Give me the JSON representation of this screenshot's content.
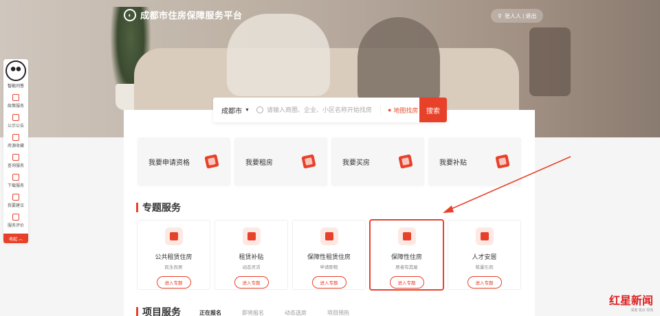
{
  "header": {
    "site_title": "成都市住房保障服务平台",
    "user_text": "张人人 | 退出"
  },
  "search": {
    "city": "成都市",
    "placeholder": "请输入商圈、企业、小区名称开始找房",
    "map_link": "地图找房",
    "button": "搜索"
  },
  "quick_cards": [
    {
      "label": "我要申请资格",
      "icon": "application-icon"
    },
    {
      "label": "我要租房",
      "icon": "rent-icon"
    },
    {
      "label": "我要买房",
      "icon": "buy-house-icon"
    },
    {
      "label": "我要补贴",
      "icon": "subsidy-icon"
    }
  ],
  "topic_section": {
    "title": "专题服务",
    "cards": [
      {
        "name": "公共租赁住房",
        "sub": "民生尚居",
        "button": "进入专题",
        "icon": "public-rental-icon"
      },
      {
        "name": "租赁补贴",
        "sub": "动态灵活",
        "button": "进入专题",
        "icon": "rent-subsidy-icon"
      },
      {
        "name": "保障性租赁住房",
        "sub": "申请即租",
        "button": "进入专题",
        "icon": "affordable-rental-icon"
      },
      {
        "name": "保障性住房",
        "sub": "居者有其屋",
        "button": "进入专题",
        "icon": "affordable-housing-icon",
        "highlighted": true
      },
      {
        "name": "人才安居",
        "sub": "筑巢引凤",
        "button": "进入专题",
        "icon": "talent-housing-icon"
      }
    ]
  },
  "project_section": {
    "title": "项目服务",
    "tabs": [
      "正在报名",
      "即将报名",
      "动态选房",
      "项目预热"
    ],
    "active_tab": "正在报名"
  },
  "sidebar": {
    "mascot_label": "智能问答",
    "items": [
      {
        "label": "政策服务",
        "icon": "policy-icon"
      },
      {
        "label": "公示公告",
        "icon": "notice-icon"
      },
      {
        "label": "房源收藏",
        "icon": "star-icon"
      },
      {
        "label": "查询服务",
        "icon": "query-icon"
      },
      {
        "label": "下载服务",
        "icon": "download-icon"
      },
      {
        "label": "我要建议",
        "icon": "mail-icon"
      },
      {
        "label": "服务评价",
        "icon": "rating-icon"
      }
    ],
    "collapse": "收起 ︿"
  },
  "watermark": {
    "main": "红星新闻",
    "sub": "深度 观点 现场"
  },
  "colors": {
    "accent": "#e8412a",
    "accent_light": "#fde9e4"
  }
}
